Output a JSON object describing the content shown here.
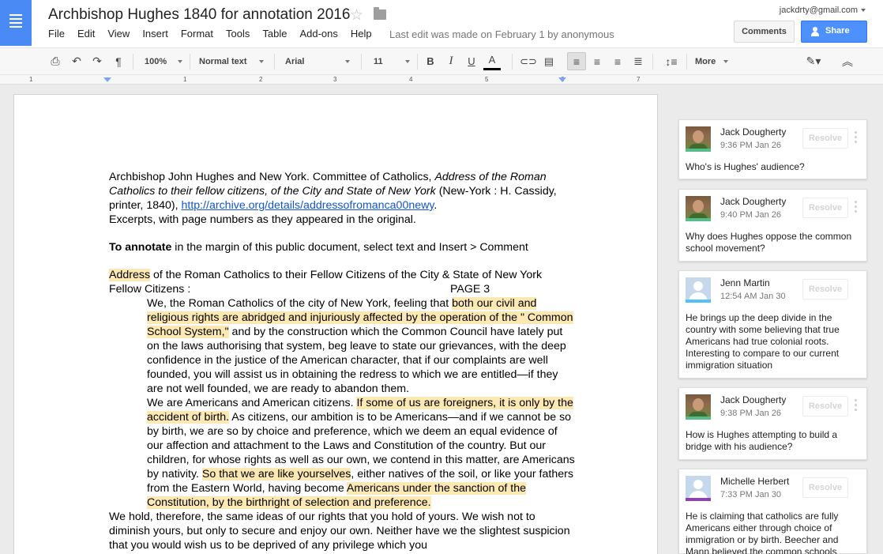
{
  "app": {
    "title": "Archbishop Hughes 1840 for annotation 2016",
    "menu": [
      "File",
      "Edit",
      "View",
      "Insert",
      "Format",
      "Tools",
      "Table",
      "Add-ons",
      "Help"
    ],
    "last_edit": "Last edit was made on February 1 by anonymous",
    "user_email": "jackdrty@gmail.com",
    "comments_label": "Comments",
    "share_label": "Share",
    "brand_color": "#4a8af4"
  },
  "toolbar": {
    "icons": [
      "print-icon",
      "undo-icon",
      "redo-icon",
      "paint-format-icon",
      "bold-icon",
      "italic-icon",
      "underline-icon",
      "text-color-icon",
      "link-icon",
      "comment-icon",
      "align-left-icon",
      "align-center-icon",
      "align-right-icon",
      "justify-icon",
      "line-spacing-icon",
      "pencil-icon",
      "collapse-icon"
    ],
    "zoom": "100%",
    "style": "Normal text",
    "font": "Arial",
    "size": "11",
    "more": "More"
  },
  "ruler": {
    "numbers": [
      "1",
      "1",
      "2",
      "3",
      "4",
      "5",
      "6",
      "7"
    ]
  },
  "doc": {
    "citation_a": "Archbishop John Hughes and New York. Committee of Catholics, ",
    "citation_italic": "Address of the Roman Catholics to their fellow citizens, of the City and State of New York",
    "citation_b": " (New-York : H. Cassidy, printer, 1840), ",
    "citation_link": "http://archive.org/details/addressofromanca00newy",
    "citation_end": ".",
    "excerpts": "Excerpts, with page numbers as they appeared in the original.",
    "annotate_bold": "To annotate",
    "annotate_rest": " in the margin of this public document, select text and Insert > Comment",
    "address_hl": "Address",
    "address_rest": " of the Roman Catholics to their Fellow Citizens of the City & State of New York",
    "fellow": "Fellow Citizens :",
    "page_label": "PAGE 3",
    "p1_a": "We, the Roman Catholics of the city of New York, feeling that ",
    "p1_hl": "both our civil and religious rights are abridged and injuriously affected by the operation of the \" Common School System,\"",
    "p1_b": " and by the construction which the Common Council have lately put on the laws authorising that system, beg leave to state our grievances, with the deep confidence in the justice of the American character, that if our complaints are well founded, you will assist us in obtaining the redress to which we are entitled—if they are not well founded, we are ready to abandon them.",
    "p2_a": "We are Americans and American citizens. ",
    "p2_hl1": "If some of us are foreigners, it is only by the accident of birth.",
    "p2_b": " As citizens, our ambition is to be Americans—and if we cannot be so by birth, we are so by choice and preference, which we deem an equal evidence of our affection and attachment to the Laws and Constitution of the country. But our children, for whose rights as well as our own, we contend in this matter, are Americans by nativity. ",
    "p2_hl2": "So that we are like yourselves",
    "p2_c": ", either natives of the soil, or like your fathers from the Eastern World, having become ",
    "p2_hl3": "Americans under the sanction of the Constitution, by the birthright of selection and preference.",
    "p3": "We hold, therefore, the same ideas of our rights that you hold of yours. We wish not to diminish yours, but only to secure and enjoy our own. Neither have we the slightest suspicion that you would wish us to be deprived of any privilege which you"
  },
  "comments": [
    {
      "name": "Jack Dougherty",
      "time": "9:36 PM Jan 26",
      "text": "Who's is Hughes' audience?",
      "resolve": "Resolve",
      "avatar": "photo",
      "bar": "#57bb8a"
    },
    {
      "name": "Jack Dougherty",
      "time": "9:40 PM Jan 26",
      "text": "Why does Hughes oppose the common school movement?",
      "resolve": "Resolve",
      "avatar": "photo",
      "bar": "#57bb8a"
    },
    {
      "name": "Jenn Martin",
      "time": "12:54 AM Jan 30",
      "text": "He brings up the deep divide in the country with some believing that true Americans had true colonial roots. Interesting to compare to our current immigration situation",
      "resolve": "Resolve",
      "avatar": "generic",
      "bar": "#4fc3f7"
    },
    {
      "name": "Jack Dougherty",
      "time": "9:38 PM Jan 26",
      "text": "How is Hughes attempting to build a bridge with his audience?",
      "resolve": "Resolve",
      "avatar": "photo",
      "bar": "#57bb8a"
    },
    {
      "name": "Michelle Herbert",
      "time": "7:33 PM Jan 30",
      "text": "He is claiming that catholics are fully Americans either through choice of immigration or by birth. Beecher and Mann believed the common schools",
      "resolve": "Resolve",
      "avatar": "generic",
      "bar": "#8e44ad"
    }
  ]
}
